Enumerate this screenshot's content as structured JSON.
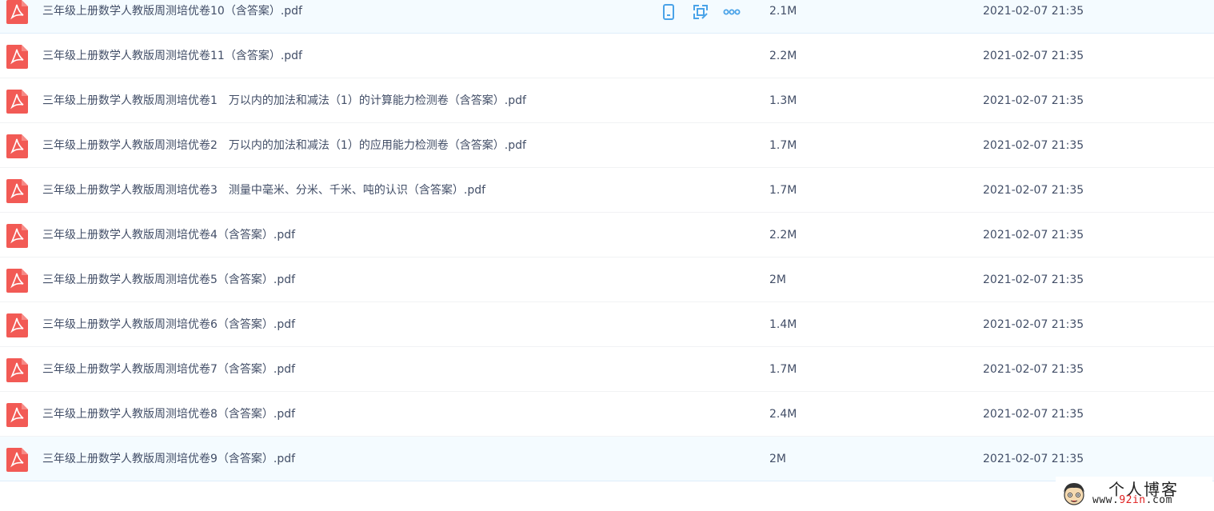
{
  "files": [
    {
      "name": "三年级上册数学人教版周测培优卷10（含答案）.pdf",
      "size": "2.1M",
      "date": "2021-02-07 21:35",
      "icon": "pdf-file-icon"
    },
    {
      "name": "三年级上册数学人教版周测培优卷11（含答案）.pdf",
      "size": "2.2M",
      "date": "2021-02-07 21:35",
      "icon": "pdf-file-icon"
    },
    {
      "name": "三年级上册数学人教版周测培优卷1　万以内的加法和减法（1）的计算能力检测卷（含答案）.pdf",
      "size": "1.3M",
      "date": "2021-02-07 21:35",
      "icon": "pdf-file-icon"
    },
    {
      "name": "三年级上册数学人教版周测培优卷2　万以内的加法和减法（1）的应用能力检测卷（含答案）.pdf",
      "size": "1.7M",
      "date": "2021-02-07 21:35",
      "icon": "pdf-file-icon"
    },
    {
      "name": "三年级上册数学人教版周测培优卷3　测量中毫米、分米、千米、吨的认识（含答案）.pdf",
      "size": "1.7M",
      "date": "2021-02-07 21:35",
      "icon": "pdf-file-icon"
    },
    {
      "name": "三年级上册数学人教版周测培优卷4（含答案）.pdf",
      "size": "2.2M",
      "date": "2021-02-07 21:35",
      "icon": "pdf-file-icon"
    },
    {
      "name": "三年级上册数学人教版周测培优卷5（含答案）.pdf",
      "size": "2M",
      "date": "2021-02-07 21:35",
      "icon": "pdf-file-icon"
    },
    {
      "name": "三年级上册数学人教版周测培优卷6（含答案）.pdf",
      "size": "1.4M",
      "date": "2021-02-07 21:35",
      "icon": "pdf-file-icon"
    },
    {
      "name": "三年级上册数学人教版周测培优卷7（含答案）.pdf",
      "size": "1.7M",
      "date": "2021-02-07 21:35",
      "icon": "pdf-file-icon"
    },
    {
      "name": "三年级上册数学人教版周测培优卷8（含答案）.pdf",
      "size": "2.4M",
      "date": "2021-02-07 21:35",
      "icon": "pdf-file-icon"
    },
    {
      "name": "三年级上册数学人教版周测培优卷9（含答案）.pdf",
      "size": "2M",
      "date": "2021-02-07 21:35",
      "icon": "pdf-file-icon"
    }
  ],
  "row_actions": [
    "phone-icon",
    "share-icon",
    "more-icon"
  ],
  "watermark": {
    "title": "个人博客",
    "url_prefix": "www.",
    "url_highlight": "92in",
    "url_suffix": ".com"
  },
  "colors": {
    "pdf_red": "#f25a55",
    "action_blue": "#4aa3e8",
    "hover_row": "#f4fbff",
    "text": "#424e67"
  }
}
